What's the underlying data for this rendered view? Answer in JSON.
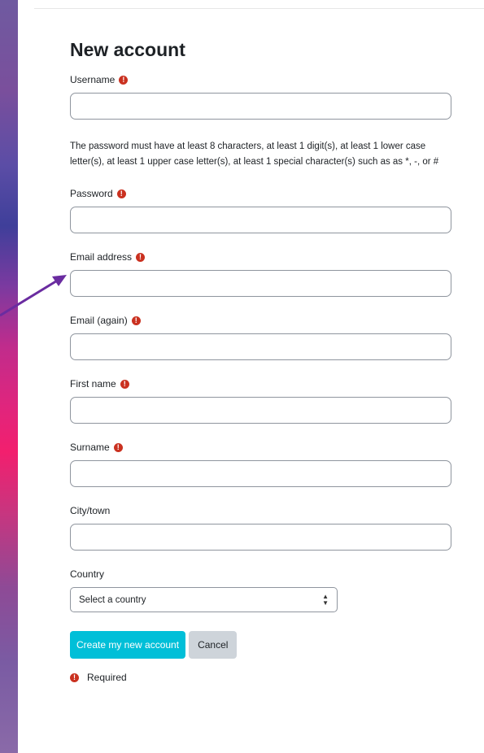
{
  "form": {
    "title": "New account",
    "required_icon": "exclamation-circle-icon",
    "username_label": "Username",
    "password_help": "The password must have at least 8 characters, at least 1 digit(s), at least 1 lower case letter(s), at least 1 upper case letter(s), at least 1 special character(s) such as as *, -, or #",
    "password_label": "Password",
    "email_label": "Email address",
    "email_again_label": "Email (again)",
    "firstname_label": "First name",
    "surname_label": "Surname",
    "city_label": "City/town",
    "country_label": "Country",
    "country_selected": "Select a country",
    "create_button": "Create my new account",
    "cancel_button": "Cancel",
    "required_note": "Required"
  },
  "colors": {
    "primary": "#00bfd8",
    "required": "#ca3120",
    "secondary_button": "#ced4da",
    "annotation_arrow": "#6a2ca0"
  }
}
